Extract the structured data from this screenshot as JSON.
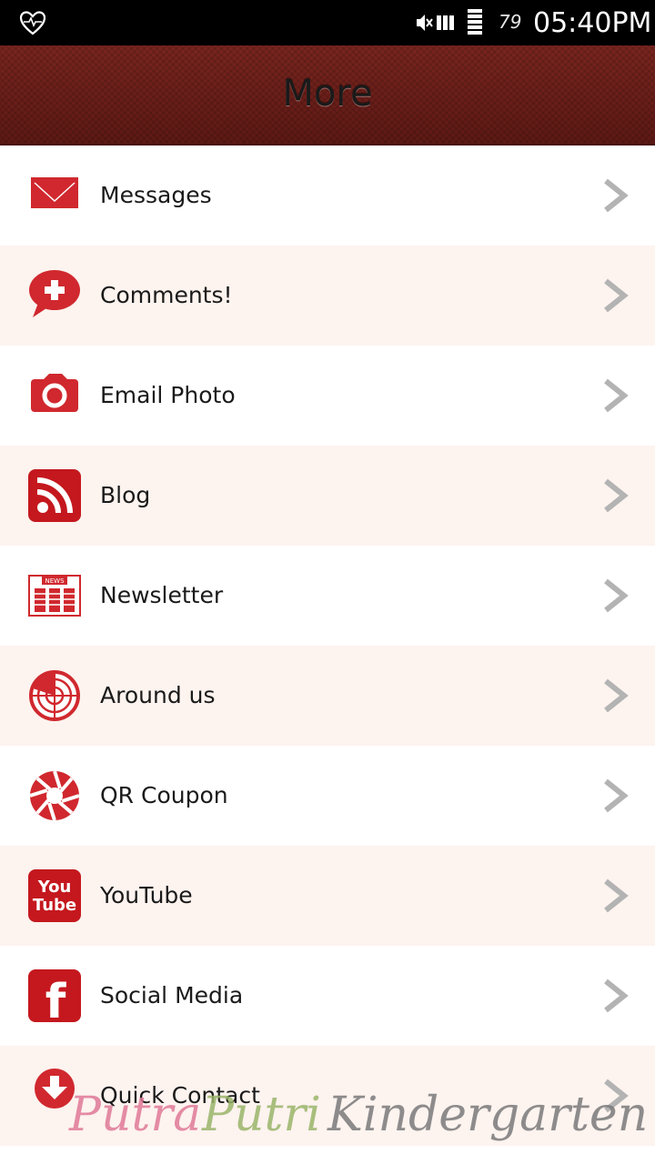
{
  "status_bar": {
    "battery_level": "79",
    "time": "05:40PM"
  },
  "header": {
    "title": "More"
  },
  "menu": {
    "items": [
      {
        "label": "Messages",
        "icon": "envelope-icon"
      },
      {
        "label": "Comments!",
        "icon": "comment-plus-icon"
      },
      {
        "label": "Email Photo",
        "icon": "camera-icon"
      },
      {
        "label": "Blog",
        "icon": "rss-icon"
      },
      {
        "label": "Newsletter",
        "icon": "newspaper-icon"
      },
      {
        "label": "Around us",
        "icon": "radar-icon"
      },
      {
        "label": "QR Coupon",
        "icon": "aperture-icon"
      },
      {
        "label": "YouTube",
        "icon": "youtube-icon"
      },
      {
        "label": "Social Media",
        "icon": "facebook-icon"
      },
      {
        "label": "Quick Contact",
        "icon": "download-icon"
      }
    ]
  },
  "icon_text": {
    "news": "NEWS",
    "you": "You",
    "tube": "Tube",
    "facebook_letter": "f"
  },
  "watermark": {
    "part1": "Putra",
    "part2": "Putri",
    "part3": "Kindergarten"
  },
  "colors": {
    "accent_red": "#d0282e",
    "header_bg": "#6e1f1a",
    "row_alt": "#fdf3ef",
    "chevron": "#b3b3b3"
  }
}
